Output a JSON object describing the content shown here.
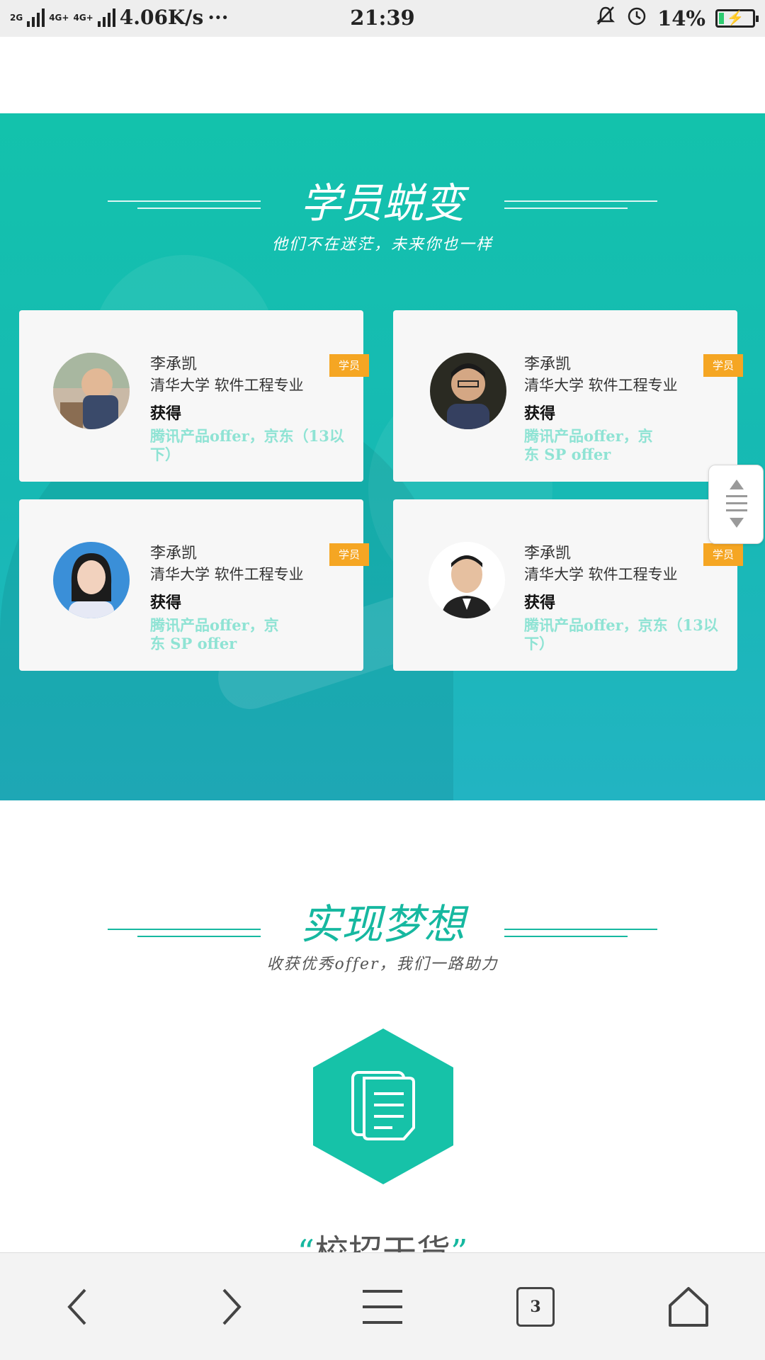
{
  "status_bar": {
    "network_labels": [
      "2G",
      "4G+",
      "4G+",
      "2G"
    ],
    "speed": "4.06K/s",
    "more": "···",
    "time": "21:39",
    "battery": "14%",
    "battery_level": 0.14
  },
  "section1": {
    "title": "学员蜕变",
    "subtitle": "他们不在迷茫，未来你也一样",
    "cards": [
      {
        "name": "李承凯",
        "school": "清华大学  软件工程专业",
        "gain_label": "获得",
        "result": "腾讯产品offer，京东（13以下）",
        "badge": "学员"
      },
      {
        "name": "李承凯",
        "school": "清华大学  软件工程专业",
        "gain_label": "获得",
        "result": "腾讯产品offer，京  东  SP  offer",
        "badge": "学员"
      },
      {
        "name": "李承凯",
        "school": "清华大学  软件工程专业",
        "gain_label": "获得",
        "result": "腾讯产品offer，京  东  SP  offer",
        "badge": "学员"
      },
      {
        "name": "李承凯",
        "school": "清华大学  软件工程专业",
        "gain_label": "获得",
        "result": "腾讯产品offer，京东（13以下）",
        "badge": "学员"
      }
    ]
  },
  "section2": {
    "title": "实现梦想",
    "subtitle": "收获优秀offer，我们一路助力",
    "quote_open": "“",
    "quote_text": "校招干货",
    "quote_close": "”"
  },
  "bottom_nav": {
    "tab_count": "3",
    "icons": [
      "back-icon",
      "forward-icon",
      "menu-icon",
      "tabs-icon",
      "home-icon"
    ]
  },
  "colors": {
    "teal": "#16b8a0",
    "badge": "#f5a623",
    "result_text": "#8fe3d4"
  }
}
